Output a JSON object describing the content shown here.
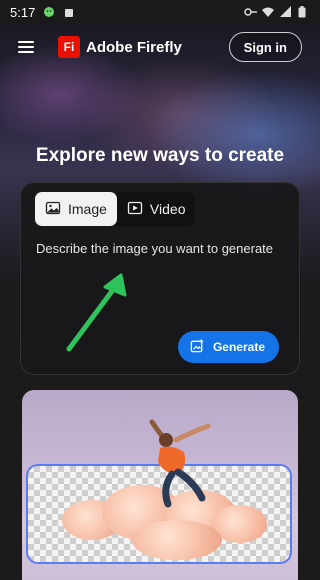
{
  "status_bar": {
    "time": "5:17"
  },
  "header": {
    "brand_logo": "Fi",
    "brand_name": "Adobe Firefly",
    "signin_label": "Sign in"
  },
  "hero": {
    "headline": "Explore new ways to create"
  },
  "generator": {
    "tabs": [
      {
        "label": "Image",
        "icon": "image-icon",
        "active": true
      },
      {
        "label": "Video",
        "icon": "video-icon",
        "active": false
      }
    ],
    "prompt_placeholder": "Describe the image you want to generate",
    "generate_label": "Generate"
  },
  "colors": {
    "accent": "#1473e6",
    "logo": "#eb1000",
    "arrow": "#2fc35b"
  }
}
